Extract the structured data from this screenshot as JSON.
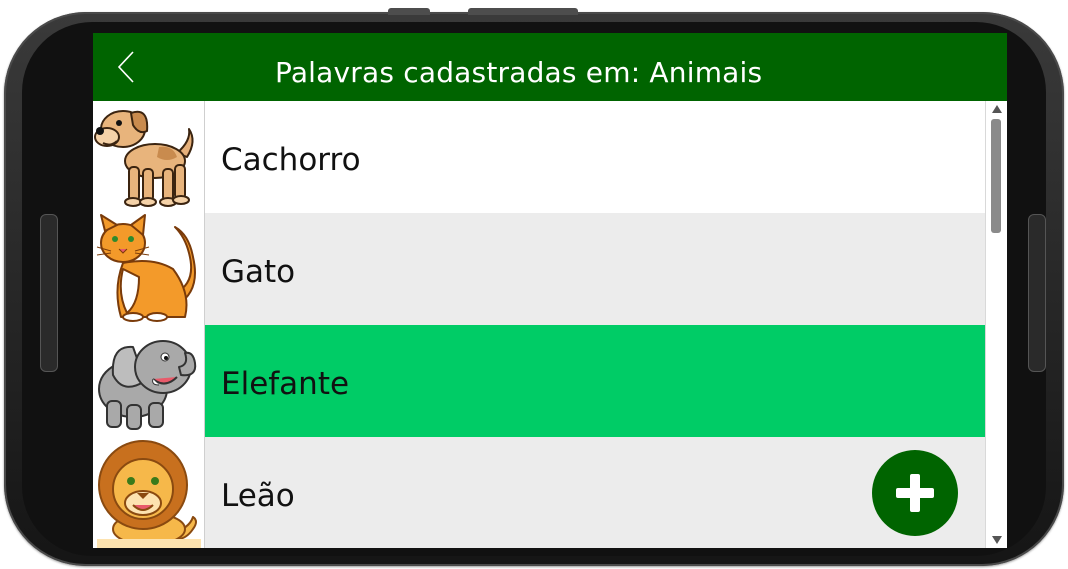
{
  "header": {
    "title": "Palavras cadastradas em: Animais",
    "back_icon": "chevron-left-icon"
  },
  "words": [
    {
      "label": "Cachorro",
      "image": "dog-icon",
      "background": "#ffffff"
    },
    {
      "label": "Gato",
      "image": "cat-icon",
      "background": "#ececec"
    },
    {
      "label": "Elefante",
      "image": "elephant-icon",
      "background": "#00cc66",
      "selected": true
    },
    {
      "label": "Leão",
      "image": "lion-icon",
      "background": "#ececec"
    }
  ],
  "fab": {
    "icon": "plus-icon"
  },
  "colors": {
    "header": "#006400",
    "selected_row": "#00cc66",
    "alt_row": "#ececec",
    "fab": "#006400"
  }
}
